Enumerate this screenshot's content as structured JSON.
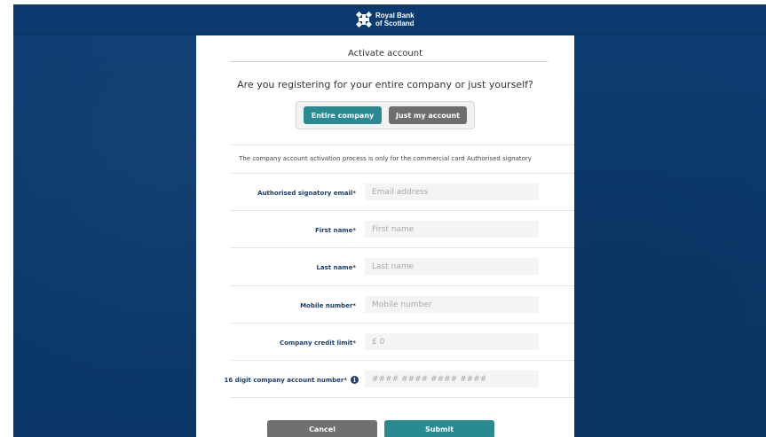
{
  "header": {
    "brand_line1": "Royal Bank",
    "brand_line2": "of Scotland",
    "logo_icon": "rbs-daisy-wheel-icon"
  },
  "form": {
    "title": "Activate account",
    "question": "Are you registering for your entire company or just yourself?",
    "toggle": {
      "entire_company_label": "Entire company",
      "just_my_account_label": "Just my account",
      "selected": "Entire company"
    },
    "notice": "The company account activation process is only for the commercial card Authorised signatory",
    "fields": [
      {
        "label": "Authorised signatory email*",
        "placeholder": "Email address",
        "value": ""
      },
      {
        "label": "First name*",
        "placeholder": "First name",
        "value": ""
      },
      {
        "label": "Last name*",
        "placeholder": "Last name",
        "value": ""
      },
      {
        "label": "Mobile number*",
        "placeholder": "Mobile number",
        "value": ""
      },
      {
        "label": "Company credit limit*",
        "placeholder": "£ 0",
        "value": ""
      },
      {
        "label": "16 digit company account number*",
        "placeholder": "#### #### #### ####",
        "value": "",
        "info_icon": "info-icon"
      }
    ],
    "cancel_label": "Cancel",
    "submit_label": "Submit"
  },
  "colors": {
    "background": "#0b3a6e",
    "accent": "#2a8a94",
    "secondary_button": "#6e6e6e",
    "label": "#1c3f6e"
  }
}
